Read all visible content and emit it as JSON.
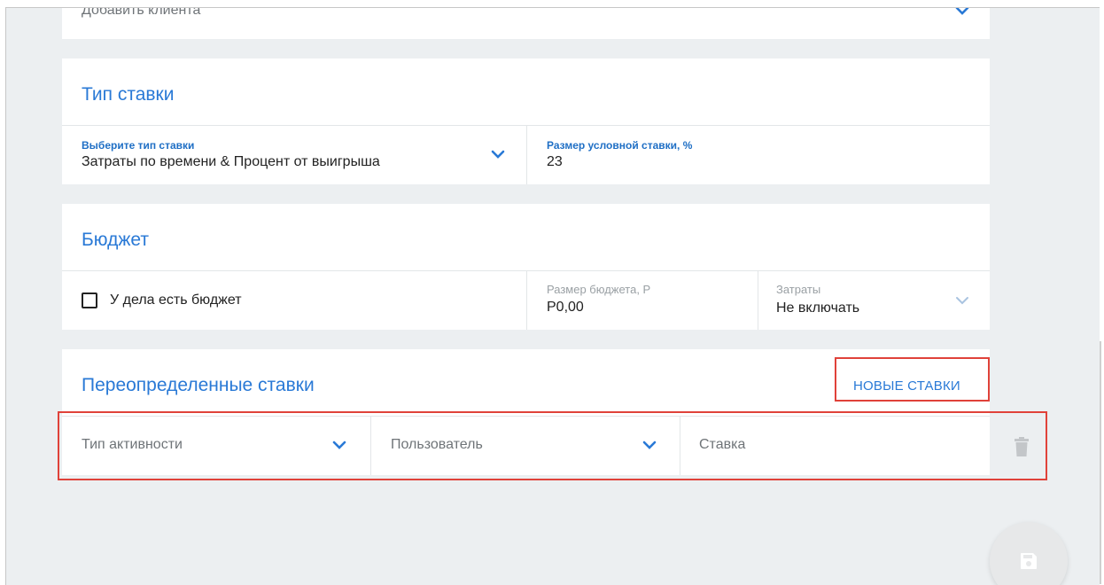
{
  "client": {
    "placeholder": "Добавить клиента"
  },
  "rate_type": {
    "heading": "Тип ставки",
    "select_label": "Выберите тип ставки",
    "select_value": "Затраты по времени & Процент от выигрыша",
    "contingency_label": "Размер условной ставки, %",
    "contingency_value": "23"
  },
  "budget": {
    "heading": "Бюджет",
    "checkbox_label": "У дела есть бюджет",
    "checkbox_checked": false,
    "amount_label": "Размер бюджета, Р",
    "amount_value": "Р0,00",
    "expenses_label": "Затраты",
    "expenses_value": "Не включать"
  },
  "overrides": {
    "heading": "Переопределенные ставки",
    "new_rates_button": "НОВЫЕ СТАВКИ",
    "row": {
      "activity_placeholder": "Тип активности",
      "user_placeholder": "Пользователь",
      "rate_placeholder": "Ставка"
    }
  },
  "icons": {
    "chevron": "chevron-down-icon",
    "trash": "trash-icon",
    "save": "save-icon"
  },
  "colors": {
    "accent": "#2979d6",
    "highlight": "#e0423a",
    "background": "#eceff1"
  }
}
